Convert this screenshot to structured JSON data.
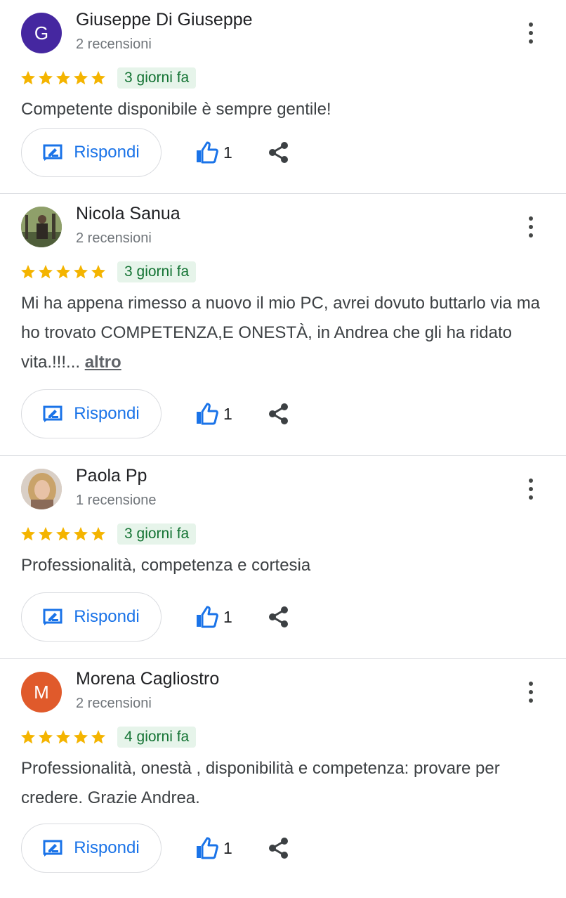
{
  "reviews": [
    {
      "initial": "G",
      "avatar_color": "#4527a0",
      "name": "Giuseppe Di Giuseppe",
      "count": "2 recensioni",
      "date": "3 giorni fa",
      "text": "Competente disponibile è sempre gentile!",
      "reply_label": "Rispondi",
      "likes": "1"
    },
    {
      "initial": "",
      "avatar_color": "#6b7a5c",
      "name": "Nicola Sanua",
      "count": "2 recensioni",
      "date": "3 giorni fa",
      "text": "Mi ha appena rimesso a nuovo il mio PC, avrei dovuto buttarlo via ma ho trovato COMPETENZA,E ONESTÀ, in Andrea che gli ha ridato vita.!!!...",
      "more_label": "altro",
      "reply_label": "Rispondi",
      "likes": "1"
    },
    {
      "initial": "",
      "avatar_color": "#c9a890",
      "name": "Paola Pp",
      "count": "1 recensione",
      "date": "3 giorni fa",
      "text": "Professionalità, competenza e cortesia",
      "reply_label": "Rispondi",
      "likes": "1"
    },
    {
      "initial": "M",
      "avatar_color": "#e05a2b",
      "name": "Morena Cagliostro",
      "count": "2 recensioni",
      "date": "4 giorni fa",
      "text": "Professionalità, onestà , disponibilità e competenza: provare per credere. Grazie Andrea.",
      "reply_label": "Rispondi",
      "likes": "1"
    }
  ],
  "rating_stars": 5,
  "colors": {
    "star": "#f4b400",
    "accent": "#1a73e8",
    "date_bg": "#e6f4ea",
    "date_text": "#137333"
  },
  "icons": {
    "more": "more-vert-icon",
    "reply": "reply-edit-icon",
    "like": "thumb-up-icon",
    "share": "share-icon"
  }
}
